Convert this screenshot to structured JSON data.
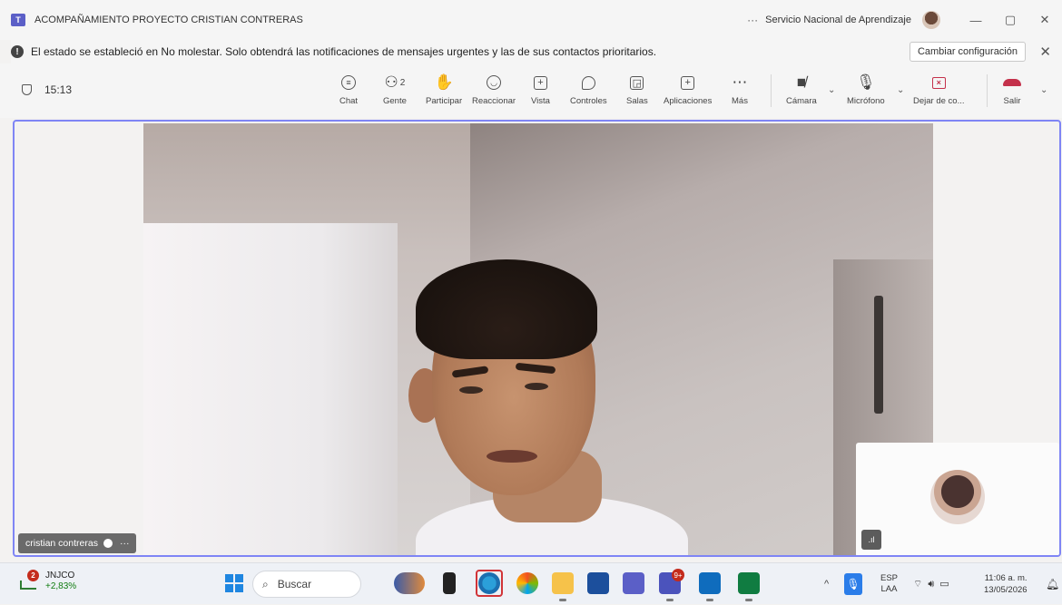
{
  "window": {
    "title": "ACOMPAÑAMIENTO PROYECTO CRISTIAN CONTRERAS",
    "org": "Servicio Nacional de Aprendizaje",
    "more_label": "···",
    "minimize_icon": "—",
    "maximize_icon": "▢",
    "close_icon": "✕"
  },
  "notification": {
    "icon": "!",
    "text": "El estado se estableció en No molestar. Solo obtendrá las notificaciones de mensajes urgentes y las de sus contactos prioritarios.",
    "button": "Cambiar configuración",
    "close_icon": "✕"
  },
  "meeting": {
    "timer": "15:13",
    "tools": {
      "chat": "Chat",
      "people": "Gente",
      "people_count": "2",
      "raise": "Participar",
      "react": "Reaccionar",
      "view": "Vista",
      "controls": "Controles",
      "rooms": "Salas",
      "apps": "Aplicaciones",
      "more": "Más",
      "camera": "Cámara",
      "mic": "Micrófono",
      "stop_share": "Dejar de co...",
      "leave": "Salir"
    },
    "participant_name": "cristian contreras",
    "name_tag_more": "···",
    "signal_icon": ".ıl"
  },
  "taskbar": {
    "widget_badge": "2",
    "widget_title": "JNJCO",
    "widget_change": "+2,83%",
    "search_label": "Buscar",
    "teams_badge": "9+",
    "lang_line1": "ESP",
    "lang_line2": "LAA",
    "time": "11:06 a. m.",
    "date": "13/05/2026"
  },
  "colors": {
    "accent": "#5b5fc7",
    "stage_border": "#7f85f5",
    "leave_red": "#c4314b",
    "taskbar": "#eef1f6"
  }
}
